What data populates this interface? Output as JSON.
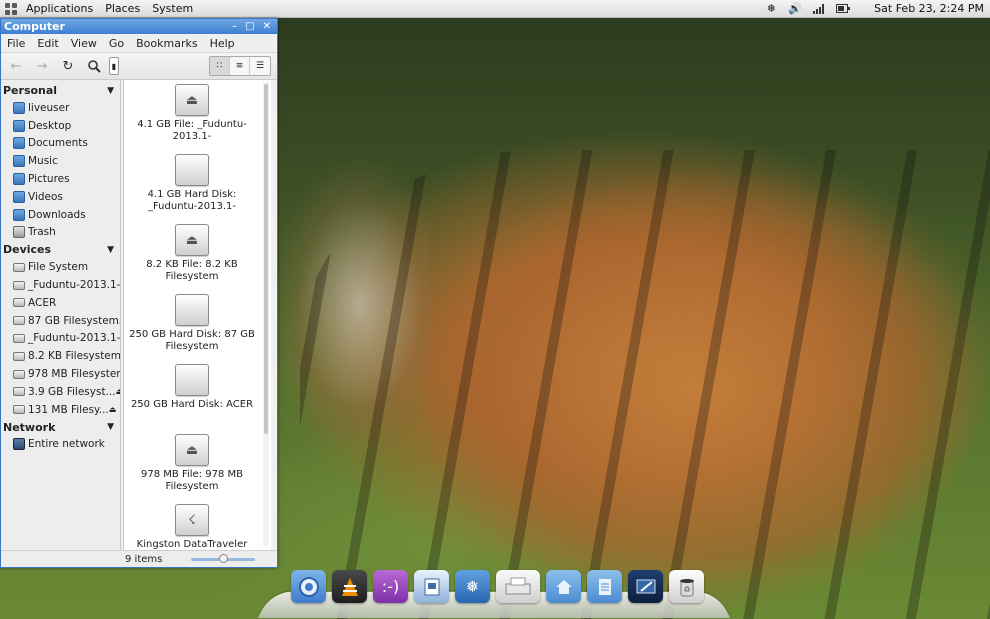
{
  "top_panel": {
    "menus": [
      "Applications",
      "Places",
      "System"
    ],
    "clock": "Sat Feb 23,  2:24 PM"
  },
  "window": {
    "title": "Computer",
    "menubar": [
      "File",
      "Edit",
      "View",
      "Go",
      "Bookmarks",
      "Help"
    ],
    "sidebar": {
      "personal_header": "Personal",
      "personal": [
        "liveuser",
        "Desktop",
        "Documents",
        "Music",
        "Pictures",
        "Videos",
        "Downloads",
        "Trash"
      ],
      "devices_header": "Devices",
      "devices": [
        "File System",
        "_Fuduntu-2013.1-",
        "ACER",
        "87 GB Filesystem",
        "_Fuduntu-2013.1-",
        "8.2 KB Filesystem",
        "978 MB Filesystem",
        "3.9 GB Filesyst...",
        "131 MB Filesy..."
      ],
      "network_header": "Network",
      "network": [
        "Entire network"
      ]
    },
    "files": [
      {
        "label": "4.1 GB File: _Fuduntu-2013.1-",
        "icon": "eject-drive-icon"
      },
      {
        "label": "4.1 GB Hard Disk: _Fuduntu-2013.1-",
        "icon": "hard-disk-icon"
      },
      {
        "label": "8.2 KB File: 8.2 KB Filesystem",
        "icon": "eject-drive-icon"
      },
      {
        "label": "250 GB Hard Disk: 87 GB Filesystem",
        "icon": "hard-disk-icon"
      },
      {
        "label": "250 GB Hard Disk: ACER",
        "icon": "hard-disk-icon"
      },
      {
        "label": "978 MB File: 978 MB Filesystem",
        "icon": "eject-drive-icon"
      },
      {
        "label": "Kingston DataTraveler",
        "icon": "usb-drive-icon"
      }
    ],
    "status": "9 items"
  },
  "dock": {
    "items": [
      "chromium-icon",
      "vlc-icon",
      "chat-icon",
      "writer-icon",
      "fuduntu-icon",
      "printer-icon",
      "home-folder-icon",
      "documents-folder-icon",
      "screenshot-icon",
      "trash-icon"
    ]
  }
}
